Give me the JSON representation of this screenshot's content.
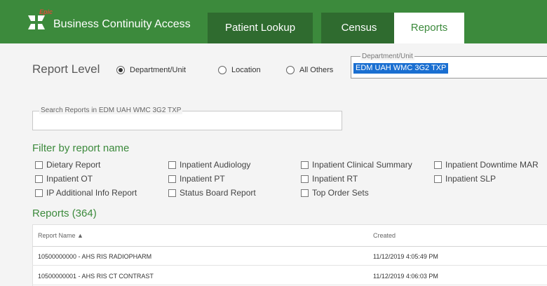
{
  "header": {
    "logo_text": "Epic",
    "app_title": "Business Continuity Access",
    "brand_color": "#3c8a3c",
    "tabs": [
      {
        "label": "Patient Lookup"
      },
      {
        "label": "Census"
      },
      {
        "label": "Reports"
      }
    ],
    "active_tab": "Reports"
  },
  "report_level": {
    "label": "Report Level",
    "options": [
      {
        "label": "Department/Unit"
      },
      {
        "label": "Location"
      },
      {
        "label": "All Others"
      }
    ],
    "selected": "Department/Unit"
  },
  "department": {
    "legend": "Department/Unit",
    "value": "EDM UAH WMC 3G2 TXP"
  },
  "search": {
    "legend": "Search Reports in EDM UAH WMC 3G2 TXP",
    "value": ""
  },
  "filter": {
    "title": "Filter by report name",
    "items": [
      {
        "label": "Dietary Report"
      },
      {
        "label": "Inpatient Audiology"
      },
      {
        "label": "Inpatient Clinical Summary"
      },
      {
        "label": "Inpatient Downtime MAR"
      },
      {
        "label": "Inpatient OT"
      },
      {
        "label": "Inpatient PT"
      },
      {
        "label": "Inpatient RT"
      },
      {
        "label": "Inpatient SLP"
      },
      {
        "label": "IP Additional Info Report"
      },
      {
        "label": "Status Board Report"
      },
      {
        "label": "Top Order Sets"
      }
    ]
  },
  "reports": {
    "title": "Reports (364)",
    "columns": {
      "name": "Report Name ▲",
      "created": "Created"
    },
    "rows": [
      {
        "name": "10500000000 - AHS RIS RADIOPHARM",
        "created": "11/12/2019 4:05:49 PM"
      },
      {
        "name": "10500000001 - AHS RIS CT CONTRAST",
        "created": "11/12/2019 4:06:03 PM"
      }
    ]
  }
}
